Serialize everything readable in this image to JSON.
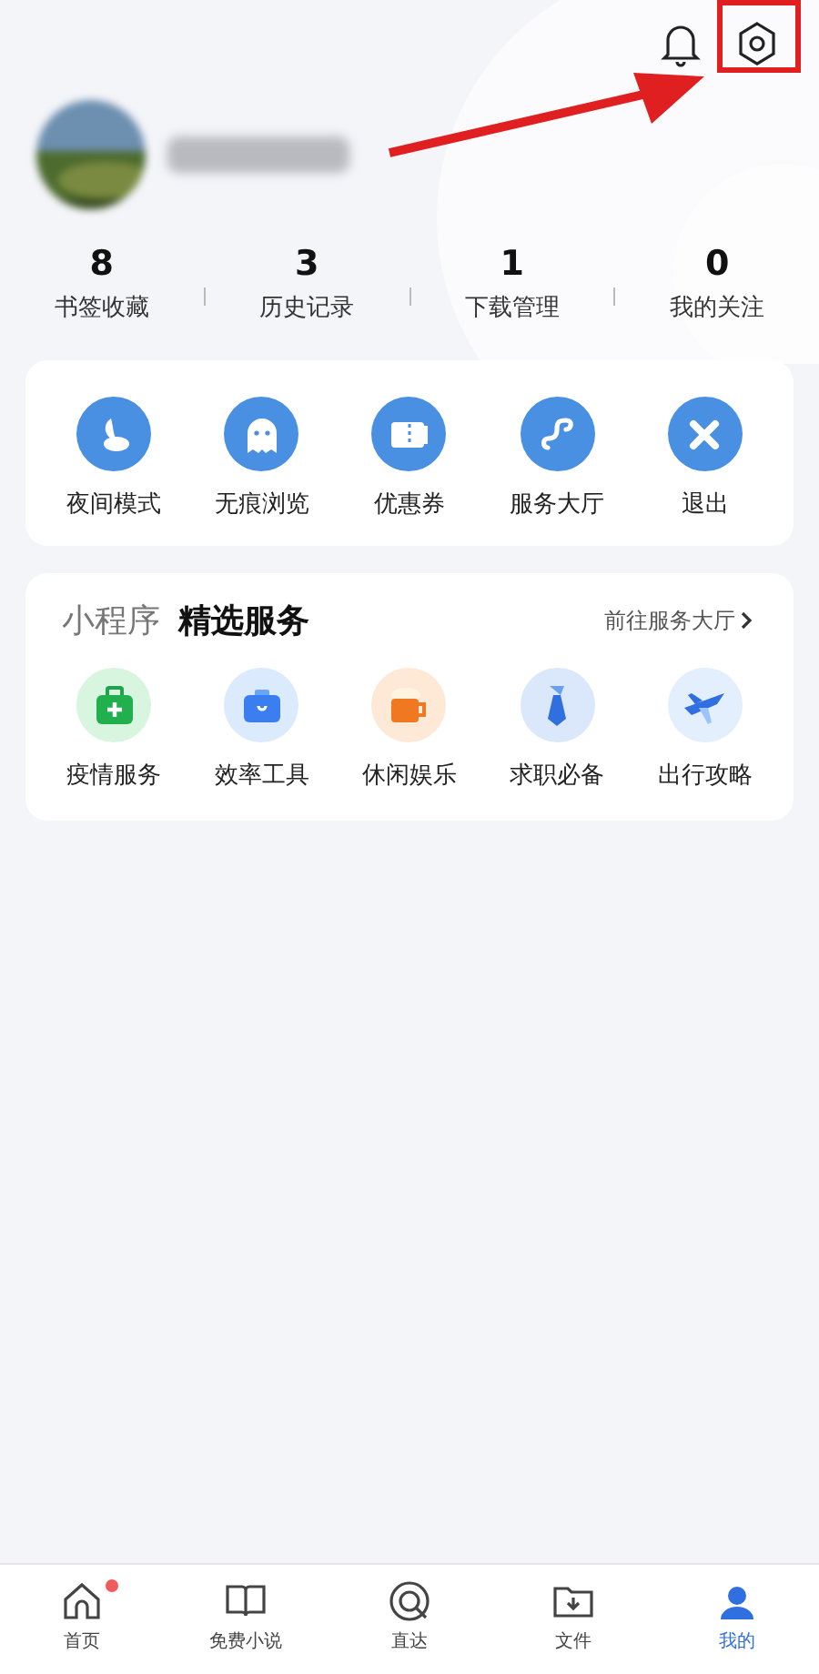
{
  "stats": [
    {
      "count": "8",
      "label": "书签收藏"
    },
    {
      "count": "3",
      "label": "历史记录"
    },
    {
      "count": "1",
      "label": "下载管理"
    },
    {
      "count": "0",
      "label": "我的关注"
    }
  ],
  "tools": [
    {
      "kind": "moon",
      "label": "夜间模式"
    },
    {
      "kind": "ghost",
      "label": "无痕浏览"
    },
    {
      "kind": "ticket",
      "label": "优惠券"
    },
    {
      "kind": "link",
      "label": "服务大厅"
    },
    {
      "kind": "close",
      "label": "退出"
    }
  ],
  "services": {
    "prefix": "小程序",
    "title": "精选服务",
    "more": "前往服务大厅",
    "items": [
      {
        "kind": "medkit",
        "label": "疫情服务",
        "color": "#d8f5df"
      },
      {
        "kind": "briefcase",
        "label": "效率工具",
        "color": "#dbeafd"
      },
      {
        "kind": "cup",
        "label": "休闲娱乐",
        "color": "#fde9d6"
      },
      {
        "kind": "tie",
        "label": "求职必备",
        "color": "#dbe8fb"
      },
      {
        "kind": "plane",
        "label": "出行攻略",
        "color": "#e3effc"
      }
    ]
  },
  "nav": [
    {
      "kind": "home",
      "label": "首页",
      "selected": false,
      "badge": true
    },
    {
      "kind": "book",
      "label": "免费小说",
      "selected": false,
      "badge": false
    },
    {
      "kind": "direct",
      "label": "直达",
      "selected": false,
      "badge": false
    },
    {
      "kind": "folder",
      "label": "文件",
      "selected": false,
      "badge": false
    },
    {
      "kind": "me",
      "label": "我的",
      "selected": true,
      "badge": false
    }
  ]
}
